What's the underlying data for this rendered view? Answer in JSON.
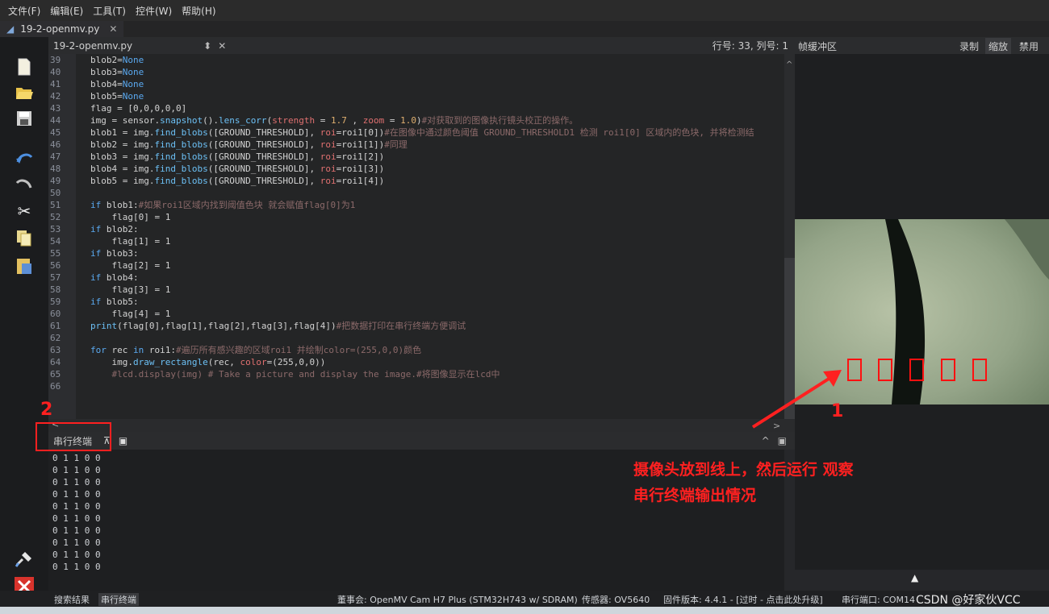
{
  "menu": [
    "文件(F)",
    "编辑(E)",
    "工具(T)",
    "控件(W)",
    "帮助(H)"
  ],
  "doc_tab": "19-2-openmv.py",
  "editor": {
    "filename": "19-2-openmv.py",
    "cursor": "行号: 33, 列号: 1",
    "lines": [
      {
        "n": "39",
        "html": "blob2=<span class=\"kw\">None</span>"
      },
      {
        "n": "40",
        "html": "blob3=<span class=\"kw\">None</span>"
      },
      {
        "n": "41",
        "html": "blob4=<span class=\"kw\">None</span>"
      },
      {
        "n": "42",
        "html": "blob5=<span class=\"kw\">None</span>"
      },
      {
        "n": "43",
        "html": "flag = [0,0,0,0,0]"
      },
      {
        "n": "44",
        "html": "img = sensor.<span class=\"fn\">snapshot</span>().<span class=\"fn\">lens_corr</span>(<span class=\"prm\">strength</span> = <span class=\"num\">1.7</span> , <span class=\"prm\">zoom</span> = <span class=\"num\">1.0</span>)<span class=\"cmt\">#对获取到的图像执行镜头校正的操作。</span>"
      },
      {
        "n": "45",
        "html": "blob1 = img.<span class=\"fn\">find_blobs</span>([GROUND_THRESHOLD], <span class=\"prm\">roi</span>=roi1[0])<span class=\"cmt\">#在图像中通过颜色阈值 GROUND_THRESHOLD1 检测 roi1[0] 区域内的色块, 并将检测结</span>"
      },
      {
        "n": "46",
        "html": "blob2 = img.<span class=\"fn\">find_blobs</span>([GROUND_THRESHOLD], <span class=\"prm\">roi</span>=roi1[1])<span class=\"cmt\">#同理</span>"
      },
      {
        "n": "47",
        "html": "blob3 = img.<span class=\"fn\">find_blobs</span>([GROUND_THRESHOLD], <span class=\"prm\">roi</span>=roi1[2])"
      },
      {
        "n": "48",
        "html": "blob4 = img.<span class=\"fn\">find_blobs</span>([GROUND_THRESHOLD], <span class=\"prm\">roi</span>=roi1[3])"
      },
      {
        "n": "49",
        "html": "blob5 = img.<span class=\"fn\">find_blobs</span>([GROUND_THRESHOLD], <span class=\"prm\">roi</span>=roi1[4])"
      },
      {
        "n": "50",
        "html": ""
      },
      {
        "n": "51",
        "html": "<span class=\"kw\">if</span> blob1:<span class=\"cmt\">#如果roi1区域内找到阈值色块 就会赋值flag[0]为1</span>"
      },
      {
        "n": "52",
        "html": "    flag[0] = 1"
      },
      {
        "n": "53",
        "html": "<span class=\"kw\">if</span> blob2:"
      },
      {
        "n": "54",
        "html": "    flag[1] = 1"
      },
      {
        "n": "55",
        "html": "<span class=\"kw\">if</span> blob3:"
      },
      {
        "n": "56",
        "html": "    flag[2] = 1"
      },
      {
        "n": "57",
        "html": "<span class=\"kw\">if</span> blob4:"
      },
      {
        "n": "58",
        "html": "    flag[3] = 1"
      },
      {
        "n": "59",
        "html": "<span class=\"kw\">if</span> blob5:"
      },
      {
        "n": "60",
        "html": "    flag[4] = 1"
      },
      {
        "n": "61",
        "html": "<span class=\"fn\">print</span>(flag[0],flag[1],flag[2],flag[3],flag[4])<span class=\"cmt\">#把数据打印在串行终端方便调试</span>"
      },
      {
        "n": "62",
        "html": ""
      },
      {
        "n": "63",
        "html": "<span class=\"kw\">for</span> rec <span class=\"kw\">in</span> roi1:<span class=\"cmt\">#遍历所有感兴趣的区域roi1 并绘制color=(255,0,0)颜色</span>"
      },
      {
        "n": "64",
        "html": "    img.<span class=\"fn\">draw_rectangle</span>(rec, <span class=\"prm\">color</span>=(255,0,0))"
      },
      {
        "n": "65",
        "html": "    <span class=\"cmt\">#lcd.display(img) # Take a picture and display the image.#将图像显示在lcd中</span>"
      },
      {
        "n": "66",
        "html": ""
      }
    ]
  },
  "terminal": {
    "tab_label": "串行终端",
    "output": [
      "0 1 1 0 0",
      "0 1 1 0 0",
      "0 1 1 0 0",
      "0 1 1 0 0",
      "0 1 1 0 0",
      "0 1 1 0 0",
      "0 1 1 0 0",
      "0 1 1 0 0",
      "0 1 1 0 0",
      "0 1 1 0 0"
    ]
  },
  "framebuffer": {
    "title": "帧缓冲区",
    "btn_record": "录制",
    "btn_zoom": "缩放",
    "btn_disable": "禁用"
  },
  "annotations": {
    "label_1": "1",
    "label_2": "2",
    "text_line1": "摄像头放到线上，然后运行 观察",
    "text_line2": "串行终端输出情况"
  },
  "status": {
    "search_results": "搜索结果",
    "serial_terminal": "串行终端",
    "board": "董事会: OpenMV Cam H7 Plus (STM32H743 w/ SDRAM)",
    "sensor": "传感器: OV5640",
    "firmware": "固件版本: 4.4.1 - [过时 - 点击此处升级]",
    "serial_port": "串行端口: COM14",
    "watermark": "CSDN @好家伙VCC"
  },
  "colors": {
    "accent_red": "#ff2020",
    "keyword": "#5aa9f0",
    "comment": "#8c6a6a"
  }
}
